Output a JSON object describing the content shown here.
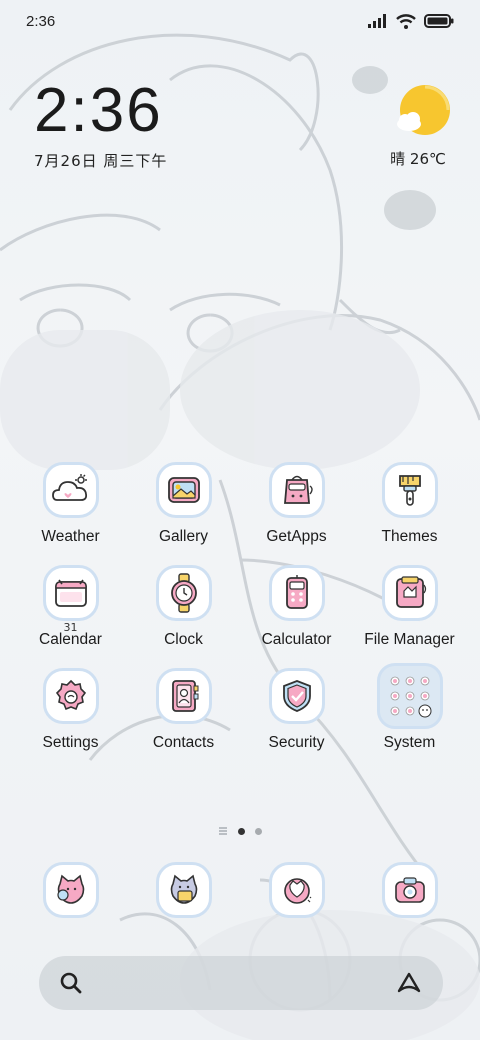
{
  "status_bar": {
    "time": "2:36"
  },
  "clock_widget": {
    "time": "2:36",
    "date": "7月26日 周三下午"
  },
  "weather_widget": {
    "condition_temp": "晴 26℃",
    "icon": "sun-cloud-icon"
  },
  "apps": [
    {
      "label": "Weather",
      "icon": "weather-cloud-icon"
    },
    {
      "label": "Gallery",
      "icon": "gallery-icon"
    },
    {
      "label": "GetApps",
      "icon": "getapps-bag-icon"
    },
    {
      "label": "Themes",
      "icon": "paintbrush-icon"
    },
    {
      "label": "Calendar",
      "icon": "calendar-icon",
      "badge": "31"
    },
    {
      "label": "Clock",
      "icon": "clock-icon"
    },
    {
      "label": "Calculator",
      "icon": "calculator-icon"
    },
    {
      "label": "File Manager",
      "icon": "file-folder-icon"
    },
    {
      "label": "Settings",
      "icon": "settings-gear-icon"
    },
    {
      "label": "Contacts",
      "icon": "contacts-book-icon"
    },
    {
      "label": "Security",
      "icon": "security-shield-icon"
    },
    {
      "label": "System",
      "icon": "system-folder-icon"
    }
  ],
  "page_indicator": {
    "pages": 2,
    "current": 1
  },
  "dock": [
    {
      "icon": "phone-cat-icon"
    },
    {
      "icon": "messages-cat-icon"
    },
    {
      "icon": "browser-icon"
    },
    {
      "icon": "camera-icon"
    }
  ],
  "colors": {
    "accent_pink": "#f6a9c4",
    "icon_border": "#cfe0f2",
    "sun_yellow": "#f7c62f"
  }
}
